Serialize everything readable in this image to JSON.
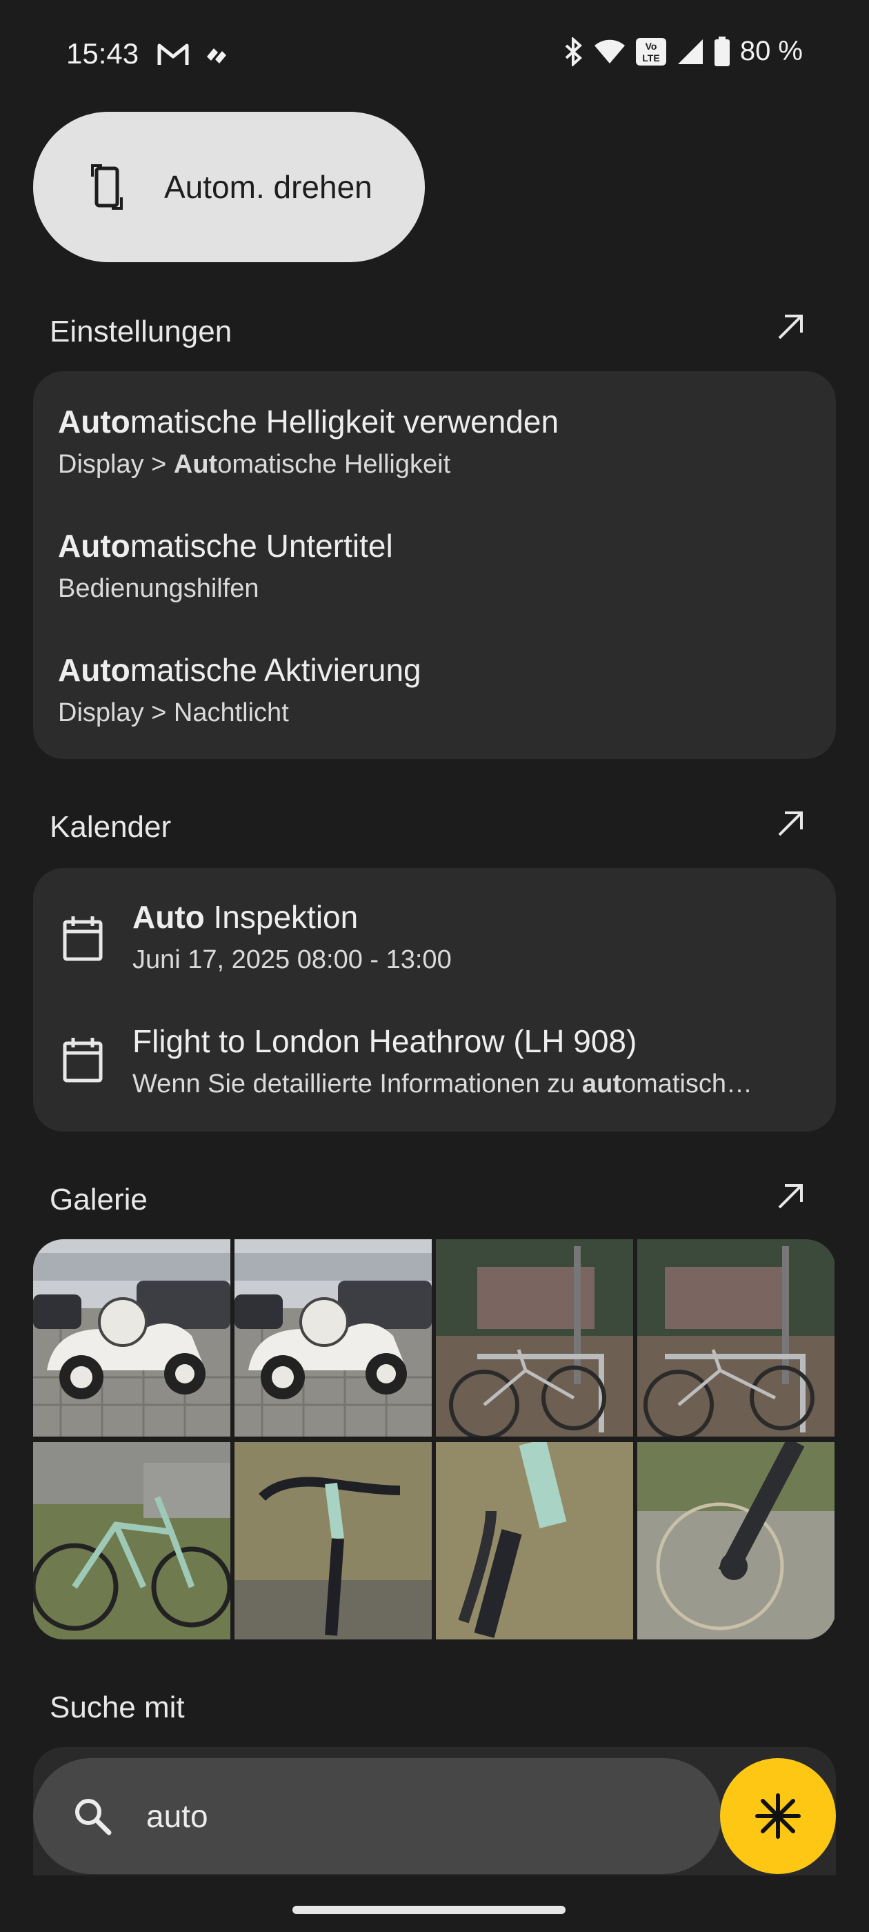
{
  "status": {
    "time": "15:43",
    "battery": "80 %",
    "volte_label": "Vo\nLTE"
  },
  "quick_setting": {
    "label": "Autom. drehen"
  },
  "settings": {
    "title": "Einstellungen",
    "items": [
      {
        "bold": "Auto",
        "rest": "matische Helligkeit verwenden",
        "sub_pre": "Display > ",
        "sub_bold": "Aut",
        "sub_rest": "omatische Helligkeit"
      },
      {
        "bold": "Auto",
        "rest": "matische Untertitel",
        "sub_pre": "Bedienungshilfen",
        "sub_bold": "",
        "sub_rest": ""
      },
      {
        "bold": "Auto",
        "rest": "matische Aktivierung",
        "sub_pre": "Display > Nachtlicht",
        "sub_bold": "",
        "sub_rest": ""
      }
    ]
  },
  "calendar": {
    "title": "Kalender",
    "items": [
      {
        "bold": "Auto",
        "rest": " Inspektion",
        "sub_pre": "Juni 17, 2025  08:00 - 13:00",
        "sub_bold": "",
        "sub_rest": ""
      },
      {
        "bold": "",
        "rest": "Flight to London Heathrow (LH 908)",
        "sub_pre": "Wenn Sie detaillierte Informationen zu ",
        "sub_bold": "aut",
        "sub_rest": "omatisch…"
      }
    ]
  },
  "gallery": {
    "title": "Galerie",
    "photos": [
      "vintage-car",
      "vintage-car",
      "bicycles-square",
      "bicycles-square",
      "gravel-bike",
      "bike-handlebar",
      "bike-fork",
      "bike-wheel"
    ]
  },
  "search_with": {
    "title": "Suche mit"
  },
  "search": {
    "query": "auto"
  },
  "colors": {
    "background": "#1c1c1c",
    "card": "#2c2c2c",
    "fab": "#fdc714",
    "chip": "#e2e2e2"
  }
}
